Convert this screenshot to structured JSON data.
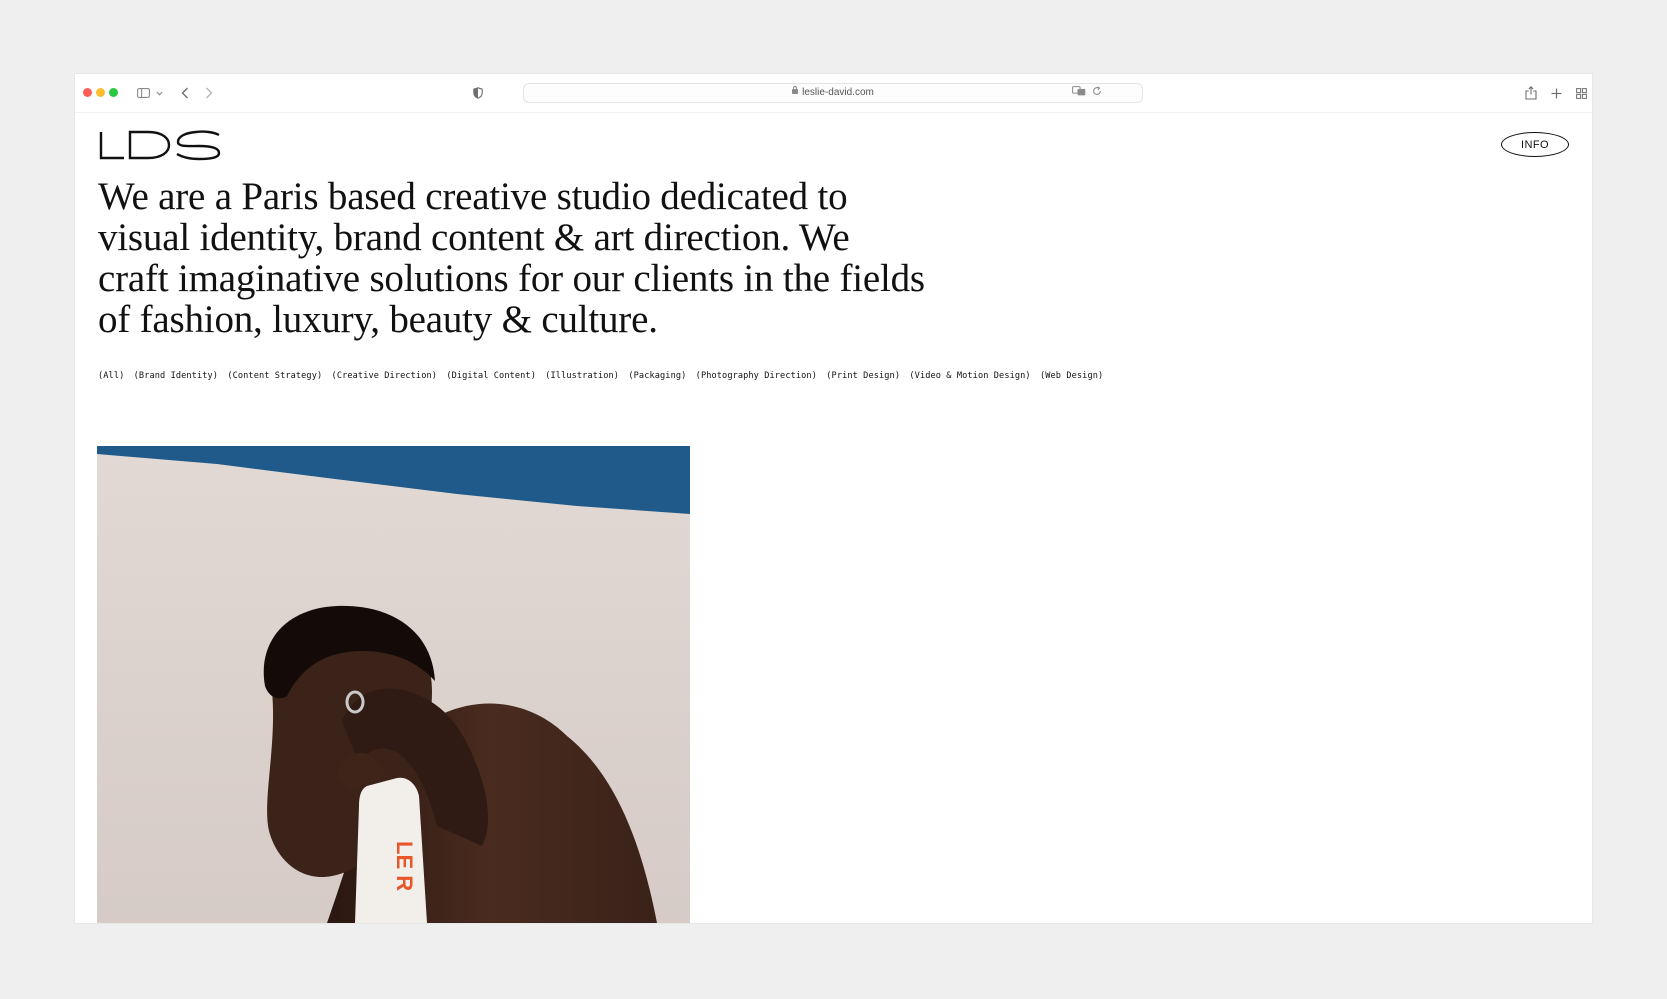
{
  "browser": {
    "url": "leslie-david.com",
    "colors": {
      "close": "#ff5f57",
      "minimize": "#febc2e",
      "zoom": "#28c840"
    },
    "icons": [
      "sidebar-icon",
      "chevron-down-icon",
      "back-icon",
      "forward-icon",
      "shield-icon",
      "lock-icon",
      "translate-icon",
      "reload-icon",
      "share-icon",
      "plus-icon",
      "tab-overview-icon"
    ]
  },
  "site": {
    "logo": "LDS",
    "info_button": "INFO",
    "headline": "We are a Paris based creative studio dedicated to visual identity, brand content & art direction. We craft imaginative solutions for our clients in the fields of fashion, luxury, beauty & culture.",
    "filters": [
      "(All)",
      "(Brand Identity)",
      "(Content Strategy)",
      "(Creative Direction)",
      "(Digital Content)",
      "(Illustration)",
      "(Packaging)",
      "(Photography Direction)",
      "(Print Design)",
      "(Video & Motion Design)",
      "(Web Design)"
    ],
    "photo": {
      "bottle_text": "LE R",
      "colors": {
        "sky": "#1f5a8a",
        "wall": "#dcd2cd",
        "skin": "#3a2219",
        "bottle_text": "#e8562a"
      }
    }
  }
}
